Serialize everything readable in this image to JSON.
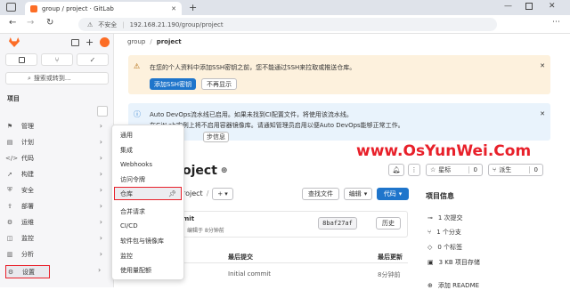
{
  "browser": {
    "tab_title": "group / project · GitLab",
    "insecure_label": "不安全",
    "url": "192.168.21.190/group/project"
  },
  "sidebar": {
    "search_label": "搜索或转到...",
    "section_label": "项目",
    "items": [
      {
        "label": "管理",
        "icon": "pin-icon"
      },
      {
        "label": "计划",
        "icon": "plan-icon"
      },
      {
        "label": "代码",
        "icon": "code-icon"
      },
      {
        "label": "构建",
        "icon": "rocket-icon"
      },
      {
        "label": "安全",
        "icon": "shield-icon"
      },
      {
        "label": "部署",
        "icon": "deploy-icon"
      },
      {
        "label": "运维",
        "icon": "operate-icon"
      },
      {
        "label": "监控",
        "icon": "monitor-icon"
      },
      {
        "label": "分析",
        "icon": "chart-icon"
      },
      {
        "label": "设置",
        "icon": "gear-icon"
      }
    ]
  },
  "settings_menu": {
    "items": [
      "通用",
      "集成",
      "Webhooks",
      "访问令牌",
      "仓库",
      "合并请求",
      "CI/CD",
      "软件包与镜像库",
      "监控",
      "使用量配额"
    ],
    "highlighted": "仓库"
  },
  "breadcrumb": {
    "group": "group",
    "project": "project"
  },
  "ssh_alert": {
    "text": "在您的个人资料中添加SSH密钥之前，您不能通过SSH来拉取或推送仓库。",
    "primary_label": "添加SSH密钥",
    "secondary_label": "不再显示"
  },
  "devops_alert": {
    "line1": "Auto DevOps流水线已启用。如果未找到CI配置文件，将使用该流水线。",
    "line2": "在GitLab实例上将不启用容器镜像库。请通知管理员启用以便Auto DevOps能够正常工作。",
    "more_label": "步信息"
  },
  "project": {
    "title": "oject",
    "star_label": "星标",
    "star_count": "0",
    "fork_label": "派生",
    "fork_count": "0",
    "path_label": "roject",
    "find_file_label": "查找文件",
    "edit_label": "编辑",
    "code_label": "代码",
    "commit_msg": "mit",
    "commit_meta": "编辑于 8分钟前",
    "commit_sha": "8baf27af",
    "history_label": "历史",
    "col_last_commit": "最后提交",
    "col_last_update": "最后更新",
    "row_commit": "Initial commit",
    "row_time": "8分钟前"
  },
  "project_info": {
    "title": "项目信息",
    "commits": "1 次提交",
    "branches": "1 个分支",
    "tags": "0 个标签",
    "storage": "3 KB 项目存储",
    "more": "添加 README"
  },
  "watermark": "www.OsYunWei.Com",
  "colors": {
    "accent": "#1f75cb",
    "highlight": "#e8202a",
    "warning_bg": "#fdf1dd",
    "info_bg": "#e9f3fc"
  }
}
